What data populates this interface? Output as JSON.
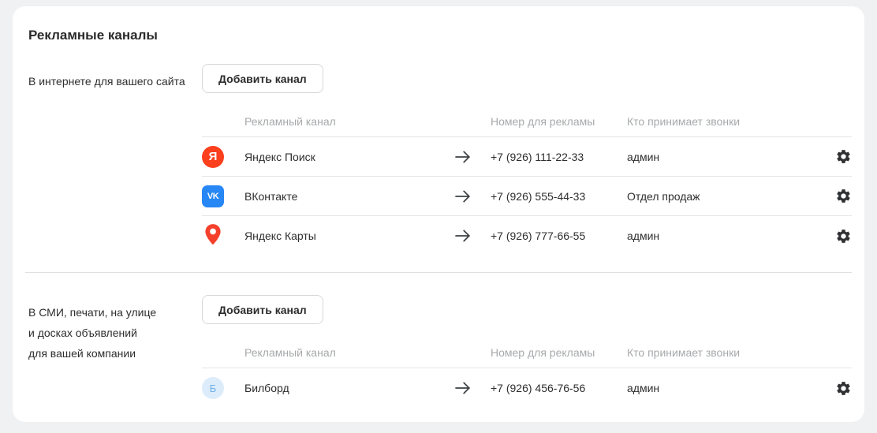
{
  "page": {
    "title": "Рекламные каналы"
  },
  "table_columns": {
    "channel": "Рекламный канал",
    "number": "Номер для рекламы",
    "receiver": "Кто принимает звонки"
  },
  "icons": {
    "settings": "gear-outline",
    "forward": "arrow-right",
    "yandex_search": "red circle with letter Я",
    "vkontakte": "blue rounded square with VK logo",
    "yandex_maps": "red map pin",
    "billboard": "light blue circle with letter Б"
  },
  "colors": {
    "page_background": "#f0f1f2",
    "card_background": "#ffffff",
    "yandex_red": "#fc3f1d",
    "vk_blue": "#2787f5",
    "billboard_bg": "#dcecfa",
    "billboard_letter": "#6fb0e9",
    "header_gray": "#a6a9ab",
    "divider": "#e4e5e6"
  },
  "sections": [
    {
      "label_lines": [
        "В интернете для вашего сайта",
        "",
        ""
      ],
      "add_button": "Добавить канал",
      "rows": [
        {
          "icon_text": "Я",
          "name": "Яндекс Поиск",
          "phone": "+7 (926) 111-22-33",
          "receiver": "админ"
        },
        {
          "icon_text": "VK",
          "name": "ВКонтакте",
          "phone": "+7 (926) 555-44-33",
          "receiver": "Отдел продаж"
        },
        {
          "icon_text": "",
          "name": "Яндекс Карты",
          "phone": "+7 (926) 777-66-55",
          "receiver": "админ"
        }
      ]
    },
    {
      "label_lines": [
        "В СМИ, печати, на улице",
        "и досках объявлений",
        "для вашей компании"
      ],
      "add_button": "Добавить канал",
      "rows": [
        {
          "icon_text": "Б",
          "name": "Билборд",
          "phone": "+7 (926) 456-76-56",
          "receiver": "админ"
        }
      ]
    }
  ]
}
